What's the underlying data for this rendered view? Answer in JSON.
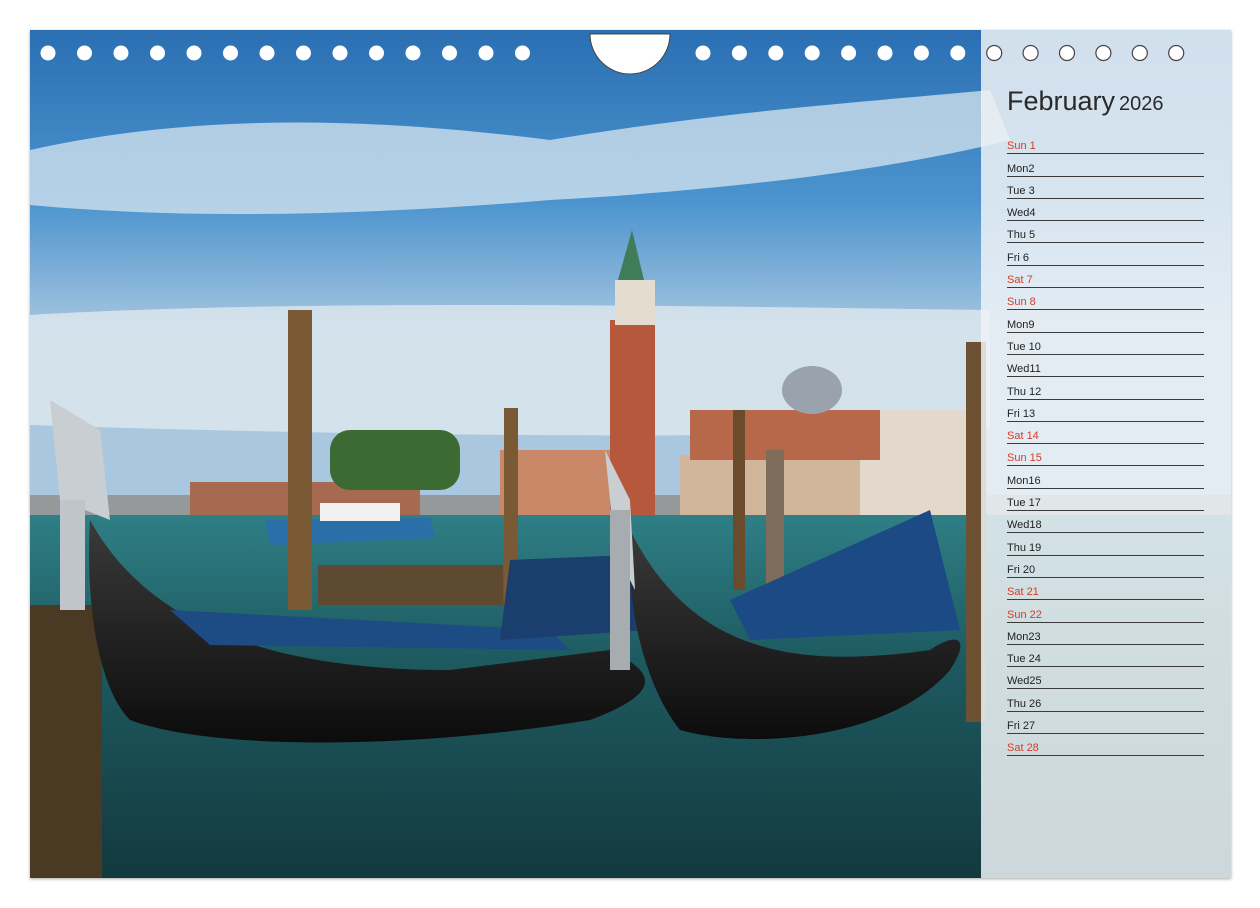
{
  "calendar": {
    "month": "February",
    "year": "2026",
    "days": [
      {
        "label": "Sun 1",
        "weekend": true
      },
      {
        "label": "Mon2",
        "weekend": false
      },
      {
        "label": "Tue 3",
        "weekend": false
      },
      {
        "label": "Wed4",
        "weekend": false
      },
      {
        "label": "Thu 5",
        "weekend": false
      },
      {
        "label": "Fri  6",
        "weekend": false
      },
      {
        "label": "Sat  7",
        "weekend": true
      },
      {
        "label": "Sun 8",
        "weekend": true
      },
      {
        "label": "Mon9",
        "weekend": false
      },
      {
        "label": "Tue 10",
        "weekend": false
      },
      {
        "label": "Wed11",
        "weekend": false
      },
      {
        "label": "Thu 12",
        "weekend": false
      },
      {
        "label": "Fri  13",
        "weekend": false
      },
      {
        "label": "Sat  14",
        "weekend": true
      },
      {
        "label": "Sun 15",
        "weekend": true
      },
      {
        "label": "Mon16",
        "weekend": false
      },
      {
        "label": "Tue 17",
        "weekend": false
      },
      {
        "label": "Wed18",
        "weekend": false
      },
      {
        "label": "Thu 19",
        "weekend": false
      },
      {
        "label": "Fri  20",
        "weekend": false
      },
      {
        "label": "Sat  21",
        "weekend": true
      },
      {
        "label": "Sun 22",
        "weekend": true
      },
      {
        "label": "Mon23",
        "weekend": false
      },
      {
        "label": "Tue 24",
        "weekend": false
      },
      {
        "label": "Wed25",
        "weekend": false
      },
      {
        "label": "Thu 26",
        "weekend": false
      },
      {
        "label": "Fri  27",
        "weekend": false
      },
      {
        "label": "Sat  28",
        "weekend": true
      }
    ]
  },
  "photo": {
    "subject": "gondolas-venice-san-giorgio-maggiore"
  },
  "colors": {
    "weekend": "#d93a22",
    "text": "#222222",
    "sky": "#3d86c4",
    "water": "#1f5a5e"
  }
}
